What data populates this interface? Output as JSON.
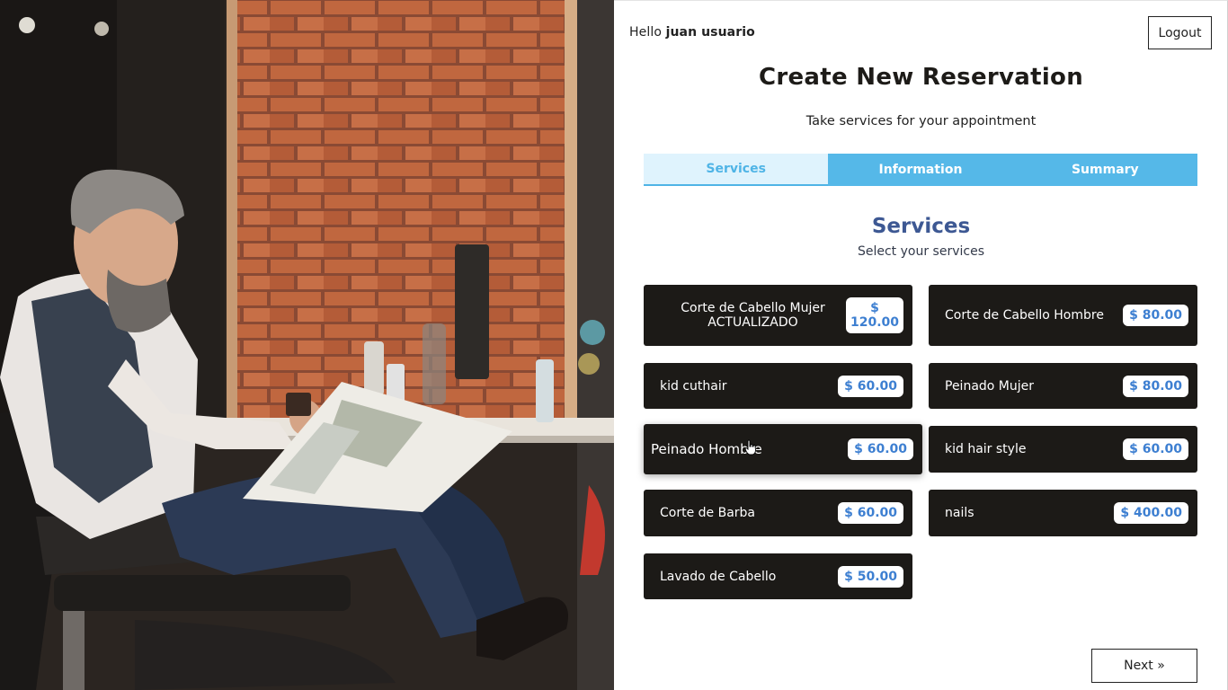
{
  "header": {
    "greeting_prefix": "Hello",
    "user_name": "juan usuario",
    "logout_label": "Logout"
  },
  "page": {
    "title": "Create New Reservation",
    "subtitle": "Take services for your appointment"
  },
  "tabs": [
    {
      "label": "Services",
      "active": true
    },
    {
      "label": "Information",
      "active": false
    },
    {
      "label": "Summary",
      "active": false
    }
  ],
  "services_section": {
    "title": "Services",
    "subtitle": "Select your services"
  },
  "services": [
    {
      "name": "Corte de Cabello Mujer ACTUALIZADO",
      "price": "$ 120.00"
    },
    {
      "name": "Corte de Cabello Hombre",
      "price": "$ 80.00"
    },
    {
      "name": "kid cuthair",
      "price": "$ 60.00"
    },
    {
      "name": "Peinado Mujer",
      "price": "$ 80.00"
    },
    {
      "name": "Peinado Hombre",
      "price": "$ 60.00"
    },
    {
      "name": "kid hair style",
      "price": "$ 60.00"
    },
    {
      "name": "Corte de Barba",
      "price": "$ 60.00"
    },
    {
      "name": "nails",
      "price": "$ 400.00"
    },
    {
      "name": "Lavado de Cabello",
      "price": "$ 50.00"
    }
  ],
  "footer": {
    "next_label": "Next »"
  },
  "colors": {
    "accent_blue": "#55b8e8",
    "active_tab_bg": "#dff3fd",
    "card_bg": "#1c1a17",
    "price_text": "#3d7fd1",
    "section_title": "#3d5893"
  }
}
